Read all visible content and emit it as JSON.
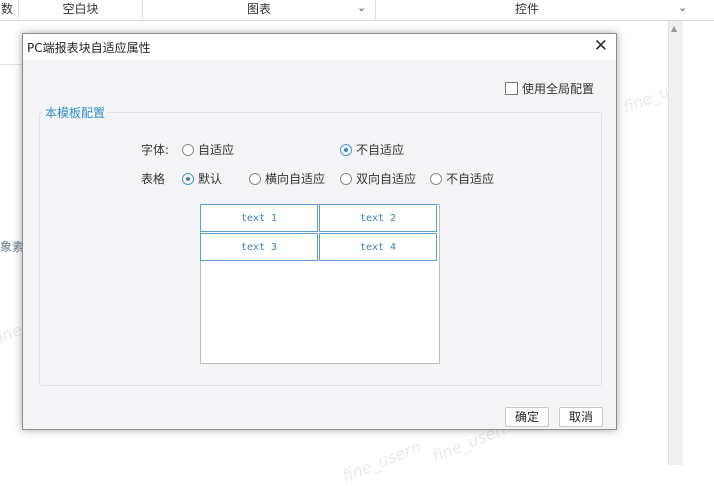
{
  "background": {
    "tabs": [
      {
        "label": "数"
      },
      {
        "label": "空白块"
      },
      {
        "label": "图表"
      },
      {
        "label": "控件"
      }
    ],
    "side_label": "象素",
    "watermarks": [
      "fine_u",
      "fine_usern",
      "fine_usern",
      "fine_usern"
    ]
  },
  "dialog": {
    "title": "PC端报表块自适应属性",
    "use_global_config": {
      "label": "使用全局配置",
      "checked": false
    },
    "group_title": "本模板配置",
    "font_row": {
      "label": "字体:",
      "options": [
        {
          "label": "自适应",
          "checked": false
        },
        {
          "label": "不自适应",
          "checked": true
        }
      ]
    },
    "table_row": {
      "label": "表格",
      "options": [
        {
          "label": "默认",
          "checked": true
        },
        {
          "label": "横向自适应",
          "checked": false
        },
        {
          "label": "双向自适应",
          "checked": false
        },
        {
          "label": "不自适应",
          "checked": false
        }
      ]
    },
    "preview_cells": [
      "text 1",
      "text 2",
      "text 3",
      "text 4"
    ],
    "buttons": {
      "ok": "确定",
      "cancel": "取消"
    }
  },
  "colors": {
    "accent": "#2e8fc6",
    "cell_border": "#5b9bd3",
    "dialog_bg": "#f4f4f6"
  }
}
